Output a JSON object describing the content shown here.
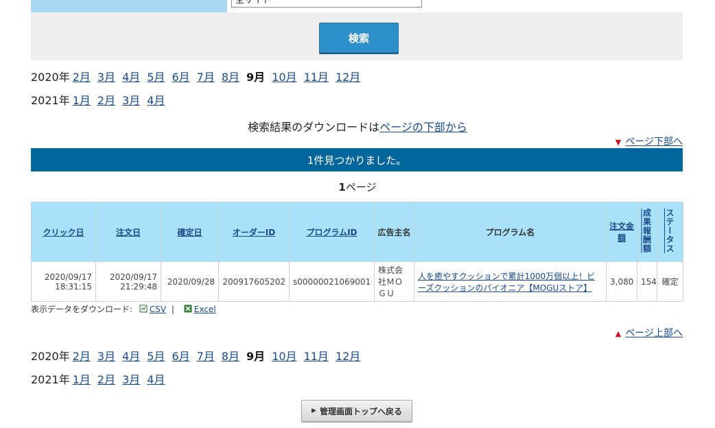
{
  "search_form": {
    "label": "",
    "select_value": "全サイト",
    "search_button": "検索"
  },
  "months_top": {
    "rows": [
      {
        "year": "2020年",
        "months": [
          "2月",
          "3月",
          "4月",
          "5月",
          "6月",
          "7月",
          "8月",
          "9月",
          "10月",
          "11月",
          "12月"
        ],
        "current": "9月"
      },
      {
        "year": "2021年",
        "months": [
          "1月",
          "2月",
          "3月",
          "4月"
        ],
        "current": ""
      }
    ]
  },
  "download_note": {
    "text": "検索結果のダウンロードは",
    "link": "ページの下部から"
  },
  "jump_bottom": "ページ下部へ",
  "jump_top": "ページ上部へ",
  "result_bar": "1件見つかりました。",
  "page_count": {
    "number": "1",
    "suffix": "ページ"
  },
  "table": {
    "headers": [
      "クリック日",
      "注文日",
      "確定日",
      "オーダーID",
      "プログラムID",
      "広告主名",
      "プログラム名",
      "注文金額",
      "成果報酬額",
      "ステータス"
    ],
    "rows": [
      {
        "click_date": "2020/09/17",
        "click_time": "18:31:15",
        "order_date": "2020/09/17",
        "order_time": "21:29:48",
        "confirm_date": "2020/09/28",
        "order_id": "200917605202",
        "program_id": "s00000021069001",
        "advertiser": "株式会社ＭＯＧＵ",
        "program_name": "人を癒やすクッションで累計1000万個以上！ビーズクッションのパイオニア【MOGUストア】",
        "order_amount": "3,080",
        "reward": "154",
        "status": "確定"
      }
    ]
  },
  "export": {
    "label": "表示データをダウンロード:",
    "csv": "CSV",
    "sep": "|",
    "excel": "Excel"
  },
  "back_button": "管理画面トップへ戻る",
  "colors": {
    "result_bar": "#00669a",
    "header_bg": "#a9e1f9",
    "search_button": "#2f8fc9",
    "accent_red": "#c4161c"
  }
}
